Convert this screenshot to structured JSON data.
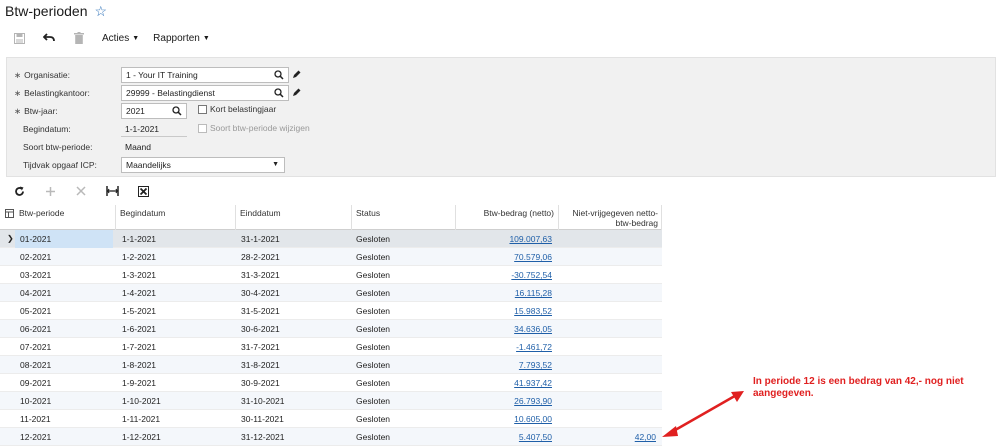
{
  "page": {
    "title": "Btw-perioden"
  },
  "toolbar": {
    "actions_label": "Acties",
    "reports_label": "Rapporten"
  },
  "form": {
    "organisation": {
      "label": "Organisatie:",
      "value": "1 - Your IT Training"
    },
    "tax_office": {
      "label": "Belastingkantoor:",
      "value": "29999 - Belastingdienst"
    },
    "tax_year": {
      "label": "Btw-jaar:",
      "value": "2021"
    },
    "short_year": {
      "label": "Kort belastingjaar"
    },
    "start_date": {
      "label": "Begindatum:",
      "value": "1-1-2021"
    },
    "change_type": {
      "label": "Soort btw-periode wijzigen"
    },
    "period_type": {
      "label": "Soort btw-periode:",
      "value": "Maand"
    },
    "icp_period": {
      "label": "Tijdvak opgaaf ICP:",
      "value": "Maandelijks"
    }
  },
  "grid": {
    "columns": [
      "Btw-periode",
      "Begindatum",
      "Einddatum",
      "Status",
      "Btw-bedrag (netto)",
      "Niet-vrijgegeven netto-",
      "btw-bedrag"
    ],
    "rows": [
      {
        "period": "01-2021",
        "start": "1-1-2021",
        "end": "31-1-2021",
        "status": "Gesloten",
        "amount": "109.007,63",
        "unreleased": ""
      },
      {
        "period": "02-2021",
        "start": "1-2-2021",
        "end": "28-2-2021",
        "status": "Gesloten",
        "amount": "70.579,06",
        "unreleased": ""
      },
      {
        "period": "03-2021",
        "start": "1-3-2021",
        "end": "31-3-2021",
        "status": "Gesloten",
        "amount": "-30.752,54",
        "unreleased": ""
      },
      {
        "period": "04-2021",
        "start": "1-4-2021",
        "end": "30-4-2021",
        "status": "Gesloten",
        "amount": "16.115,28",
        "unreleased": ""
      },
      {
        "period": "05-2021",
        "start": "1-5-2021",
        "end": "31-5-2021",
        "status": "Gesloten",
        "amount": "15.983,52",
        "unreleased": ""
      },
      {
        "period": "06-2021",
        "start": "1-6-2021",
        "end": "30-6-2021",
        "status": "Gesloten",
        "amount": "34.636,05",
        "unreleased": ""
      },
      {
        "period": "07-2021",
        "start": "1-7-2021",
        "end": "31-7-2021",
        "status": "Gesloten",
        "amount": "-1.461,72",
        "unreleased": ""
      },
      {
        "period": "08-2021",
        "start": "1-8-2021",
        "end": "31-8-2021",
        "status": "Gesloten",
        "amount": "7.793,52",
        "unreleased": ""
      },
      {
        "period": "09-2021",
        "start": "1-9-2021",
        "end": "30-9-2021",
        "status": "Gesloten",
        "amount": "41.937,42",
        "unreleased": ""
      },
      {
        "period": "10-2021",
        "start": "1-10-2021",
        "end": "31-10-2021",
        "status": "Gesloten",
        "amount": "26.793,90",
        "unreleased": ""
      },
      {
        "period": "11-2021",
        "start": "1-11-2021",
        "end": "30-11-2021",
        "status": "Gesloten",
        "amount": "10.605,00",
        "unreleased": ""
      },
      {
        "period": "12-2021",
        "start": "1-12-2021",
        "end": "31-12-2021",
        "status": "Gesloten",
        "amount": "5.407,50",
        "unreleased": "42,00"
      }
    ]
  },
  "annotation": {
    "text": "In periode 12 is een bedrag van 42,- nog niet aangegeven.",
    "color": "#e02020"
  },
  "colors": {
    "accent": "#2a6fb8",
    "link": "#1f5fa8",
    "selection": "#cfe3f6"
  }
}
